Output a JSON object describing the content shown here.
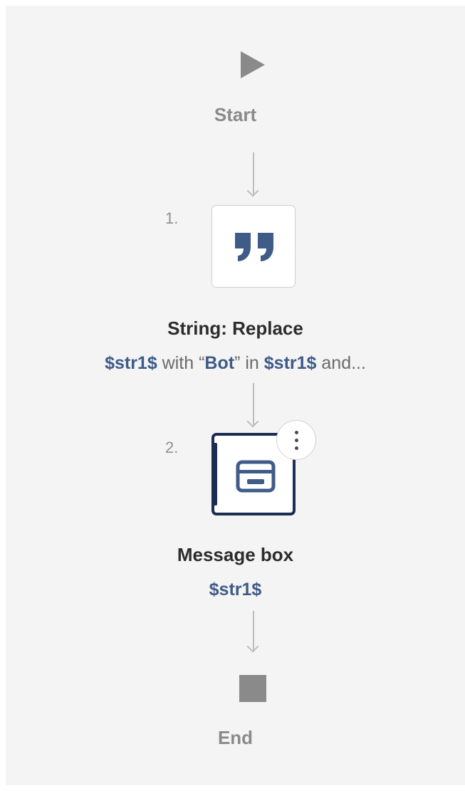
{
  "flow": {
    "start_label": "Start",
    "end_label": "End",
    "steps": [
      {
        "number": "1.",
        "title": "String: Replace",
        "subtitle": {
          "var1": "$str1$",
          "text1": " with “",
          "literal": "Bot",
          "text2": "” in ",
          "var2": "$str1$",
          "text3": " and..."
        },
        "icon": "quote-icon"
      },
      {
        "number": "2.",
        "title": "Message box",
        "subtitle_var": "$str1$",
        "icon": "message-box-icon",
        "selected": true
      }
    ]
  },
  "colors": {
    "canvas": "#f4f4f4",
    "accent_dark": "#1b2d52",
    "variable": "#3f5b87",
    "muted": "#8a8a8a"
  }
}
